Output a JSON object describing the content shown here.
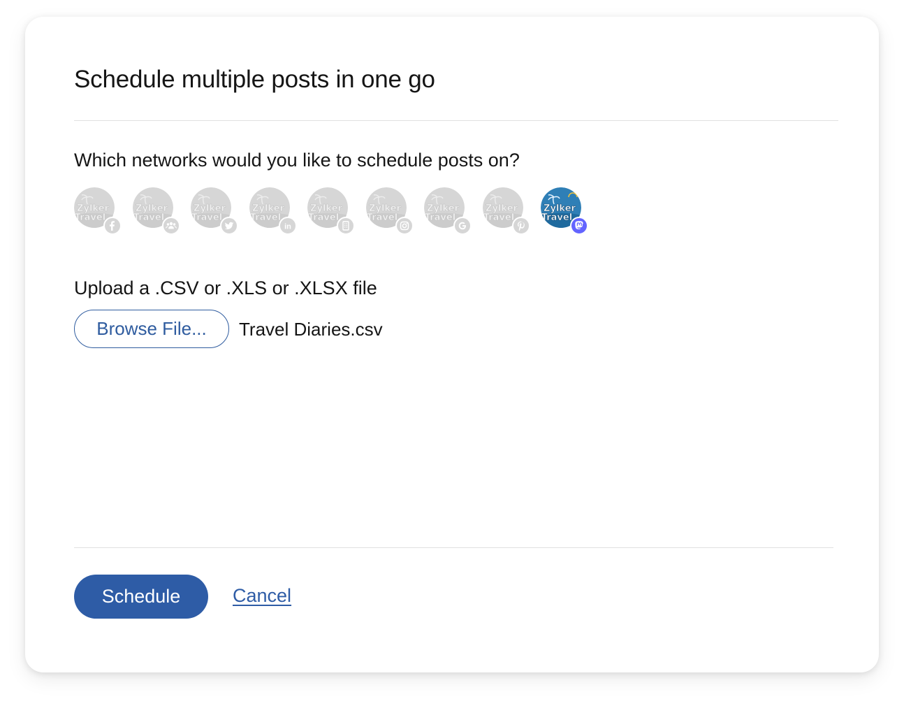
{
  "dialog": {
    "title": "Schedule multiple posts in one go",
    "networks_question": "Which networks would you like to schedule posts on?",
    "networks": [
      {
        "account": "Zylker Travel",
        "network": "Facebook",
        "icon": "facebook-icon",
        "selected": false
      },
      {
        "account": "Zylker Travel",
        "network": "Facebook Group",
        "icon": "group-icon",
        "selected": false
      },
      {
        "account": "Zylker Travel",
        "network": "Twitter",
        "icon": "twitter-icon",
        "selected": false
      },
      {
        "account": "Zylker Travel",
        "network": "LinkedIn",
        "icon": "linkedin-icon",
        "selected": false
      },
      {
        "account": "Zylker Travel",
        "network": "LinkedIn Page",
        "icon": "building-icon",
        "selected": false
      },
      {
        "account": "Zylker Travel",
        "network": "Instagram",
        "icon": "instagram-icon",
        "selected": false
      },
      {
        "account": "Zylker Travel",
        "network": "Google My Business",
        "icon": "google-icon",
        "selected": false
      },
      {
        "account": "Zylker Travel",
        "network": "Pinterest",
        "icon": "pinterest-icon",
        "selected": false
      },
      {
        "account": "Zylker Travel",
        "network": "Mastodon",
        "icon": "mastodon-icon",
        "selected": true
      }
    ],
    "upload_label": "Upload a .CSV or .XLS or .XLSX file",
    "browse_button": "Browse File...",
    "file_name": "Travel Diaries.csv",
    "schedule_button": "Schedule",
    "cancel_link": "Cancel"
  },
  "colors": {
    "primary": "#2e5ca6",
    "inactive": "#d6d6d6",
    "mastodon": "#6364ff"
  }
}
